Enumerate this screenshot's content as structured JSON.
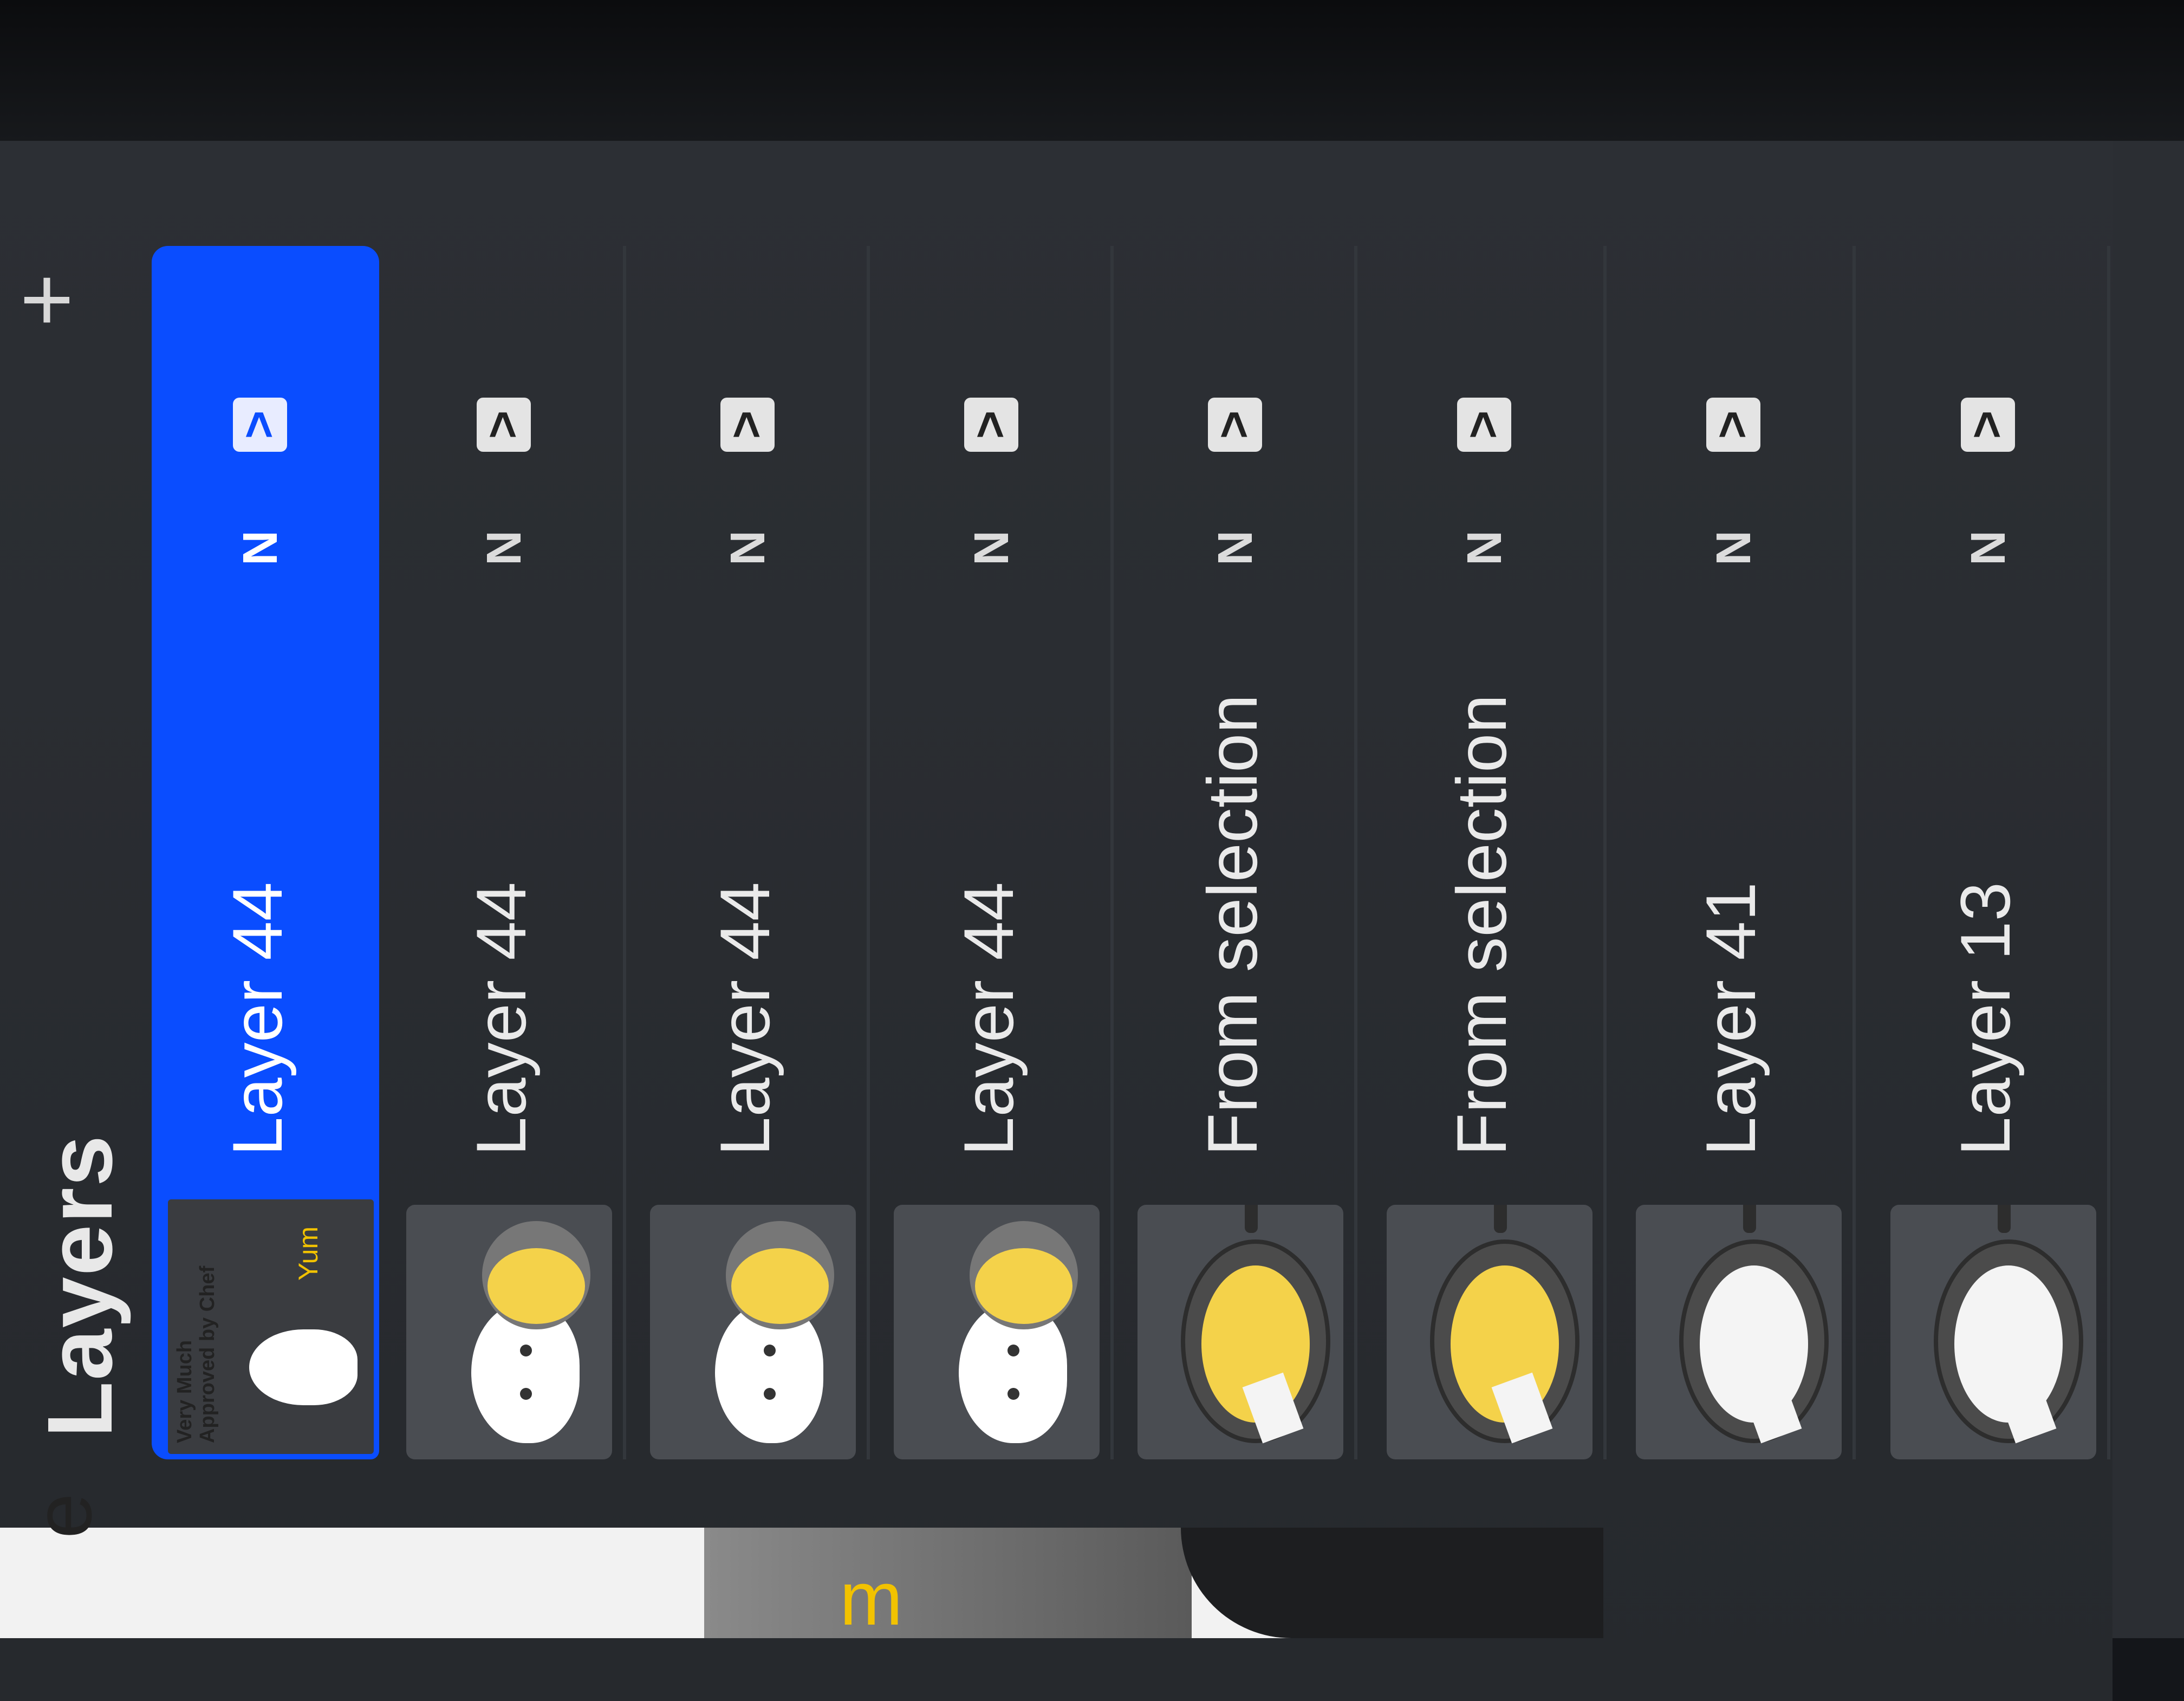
{
  "panel": {
    "title": "Layers",
    "add_symbol": "+",
    "layers": [
      {
        "label": "Layer 44",
        "blend": "N",
        "selected": true,
        "thumb": "badge",
        "thumb_text_1": "Very Much",
        "thumb_text_2": "Approved by Chef",
        "thumb_yum": "Yum"
      },
      {
        "label": "Layer 44",
        "blend": "N",
        "selected": false,
        "thumb": "cat"
      },
      {
        "label": "Layer 44",
        "blend": "N",
        "selected": false,
        "thumb": "cat"
      },
      {
        "label": "Layer 44",
        "blend": "N",
        "selected": false,
        "thumb": "cat"
      },
      {
        "label": "From selection",
        "blend": "N",
        "selected": false,
        "thumb": "pan-yellow"
      },
      {
        "label": "From selection",
        "blend": "N",
        "selected": false,
        "thumb": "pan-yellow"
      },
      {
        "label": "Layer 41",
        "blend": "N",
        "selected": false,
        "thumb": "pan-white"
      },
      {
        "label": "Layer 13",
        "blend": "N",
        "selected": false,
        "thumb": "pan-white"
      }
    ],
    "chevron_symbol": ">"
  },
  "colors": {
    "selection": "#0a4dff",
    "panel_bg": "#2c2f34",
    "row_divider": "#33373c"
  },
  "canvas_peek": {
    "letters": "e",
    "yellow_letter": "m"
  }
}
